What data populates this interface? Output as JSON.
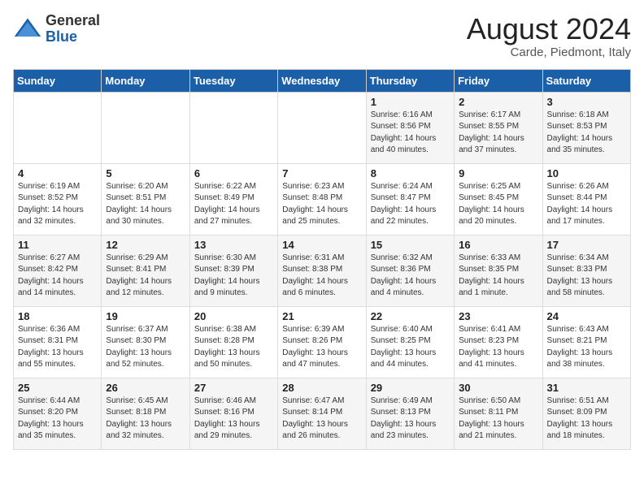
{
  "header": {
    "logo_line1": "General",
    "logo_line2": "Blue",
    "month_year": "August 2024",
    "location": "Carde, Piedmont, Italy"
  },
  "weekdays": [
    "Sunday",
    "Monday",
    "Tuesday",
    "Wednesday",
    "Thursday",
    "Friday",
    "Saturday"
  ],
  "weeks": [
    [
      {
        "day": "",
        "info": ""
      },
      {
        "day": "",
        "info": ""
      },
      {
        "day": "",
        "info": ""
      },
      {
        "day": "",
        "info": ""
      },
      {
        "day": "1",
        "info": "Sunrise: 6:16 AM\nSunset: 8:56 PM\nDaylight: 14 hours\nand 40 minutes."
      },
      {
        "day": "2",
        "info": "Sunrise: 6:17 AM\nSunset: 8:55 PM\nDaylight: 14 hours\nand 37 minutes."
      },
      {
        "day": "3",
        "info": "Sunrise: 6:18 AM\nSunset: 8:53 PM\nDaylight: 14 hours\nand 35 minutes."
      }
    ],
    [
      {
        "day": "4",
        "info": "Sunrise: 6:19 AM\nSunset: 8:52 PM\nDaylight: 14 hours\nand 32 minutes."
      },
      {
        "day": "5",
        "info": "Sunrise: 6:20 AM\nSunset: 8:51 PM\nDaylight: 14 hours\nand 30 minutes."
      },
      {
        "day": "6",
        "info": "Sunrise: 6:22 AM\nSunset: 8:49 PM\nDaylight: 14 hours\nand 27 minutes."
      },
      {
        "day": "7",
        "info": "Sunrise: 6:23 AM\nSunset: 8:48 PM\nDaylight: 14 hours\nand 25 minutes."
      },
      {
        "day": "8",
        "info": "Sunrise: 6:24 AM\nSunset: 8:47 PM\nDaylight: 14 hours\nand 22 minutes."
      },
      {
        "day": "9",
        "info": "Sunrise: 6:25 AM\nSunset: 8:45 PM\nDaylight: 14 hours\nand 20 minutes."
      },
      {
        "day": "10",
        "info": "Sunrise: 6:26 AM\nSunset: 8:44 PM\nDaylight: 14 hours\nand 17 minutes."
      }
    ],
    [
      {
        "day": "11",
        "info": "Sunrise: 6:27 AM\nSunset: 8:42 PM\nDaylight: 14 hours\nand 14 minutes."
      },
      {
        "day": "12",
        "info": "Sunrise: 6:29 AM\nSunset: 8:41 PM\nDaylight: 14 hours\nand 12 minutes."
      },
      {
        "day": "13",
        "info": "Sunrise: 6:30 AM\nSunset: 8:39 PM\nDaylight: 14 hours\nand 9 minutes."
      },
      {
        "day": "14",
        "info": "Sunrise: 6:31 AM\nSunset: 8:38 PM\nDaylight: 14 hours\nand 6 minutes."
      },
      {
        "day": "15",
        "info": "Sunrise: 6:32 AM\nSunset: 8:36 PM\nDaylight: 14 hours\nand 4 minutes."
      },
      {
        "day": "16",
        "info": "Sunrise: 6:33 AM\nSunset: 8:35 PM\nDaylight: 14 hours\nand 1 minute."
      },
      {
        "day": "17",
        "info": "Sunrise: 6:34 AM\nSunset: 8:33 PM\nDaylight: 13 hours\nand 58 minutes."
      }
    ],
    [
      {
        "day": "18",
        "info": "Sunrise: 6:36 AM\nSunset: 8:31 PM\nDaylight: 13 hours\nand 55 minutes."
      },
      {
        "day": "19",
        "info": "Sunrise: 6:37 AM\nSunset: 8:30 PM\nDaylight: 13 hours\nand 52 minutes."
      },
      {
        "day": "20",
        "info": "Sunrise: 6:38 AM\nSunset: 8:28 PM\nDaylight: 13 hours\nand 50 minutes."
      },
      {
        "day": "21",
        "info": "Sunrise: 6:39 AM\nSunset: 8:26 PM\nDaylight: 13 hours\nand 47 minutes."
      },
      {
        "day": "22",
        "info": "Sunrise: 6:40 AM\nSunset: 8:25 PM\nDaylight: 13 hours\nand 44 minutes."
      },
      {
        "day": "23",
        "info": "Sunrise: 6:41 AM\nSunset: 8:23 PM\nDaylight: 13 hours\nand 41 minutes."
      },
      {
        "day": "24",
        "info": "Sunrise: 6:43 AM\nSunset: 8:21 PM\nDaylight: 13 hours\nand 38 minutes."
      }
    ],
    [
      {
        "day": "25",
        "info": "Sunrise: 6:44 AM\nSunset: 8:20 PM\nDaylight: 13 hours\nand 35 minutes."
      },
      {
        "day": "26",
        "info": "Sunrise: 6:45 AM\nSunset: 8:18 PM\nDaylight: 13 hours\nand 32 minutes."
      },
      {
        "day": "27",
        "info": "Sunrise: 6:46 AM\nSunset: 8:16 PM\nDaylight: 13 hours\nand 29 minutes."
      },
      {
        "day": "28",
        "info": "Sunrise: 6:47 AM\nSunset: 8:14 PM\nDaylight: 13 hours\nand 26 minutes."
      },
      {
        "day": "29",
        "info": "Sunrise: 6:49 AM\nSunset: 8:13 PM\nDaylight: 13 hours\nand 23 minutes."
      },
      {
        "day": "30",
        "info": "Sunrise: 6:50 AM\nSunset: 8:11 PM\nDaylight: 13 hours\nand 21 minutes."
      },
      {
        "day": "31",
        "info": "Sunrise: 6:51 AM\nSunset: 8:09 PM\nDaylight: 13 hours\nand 18 minutes."
      }
    ]
  ]
}
